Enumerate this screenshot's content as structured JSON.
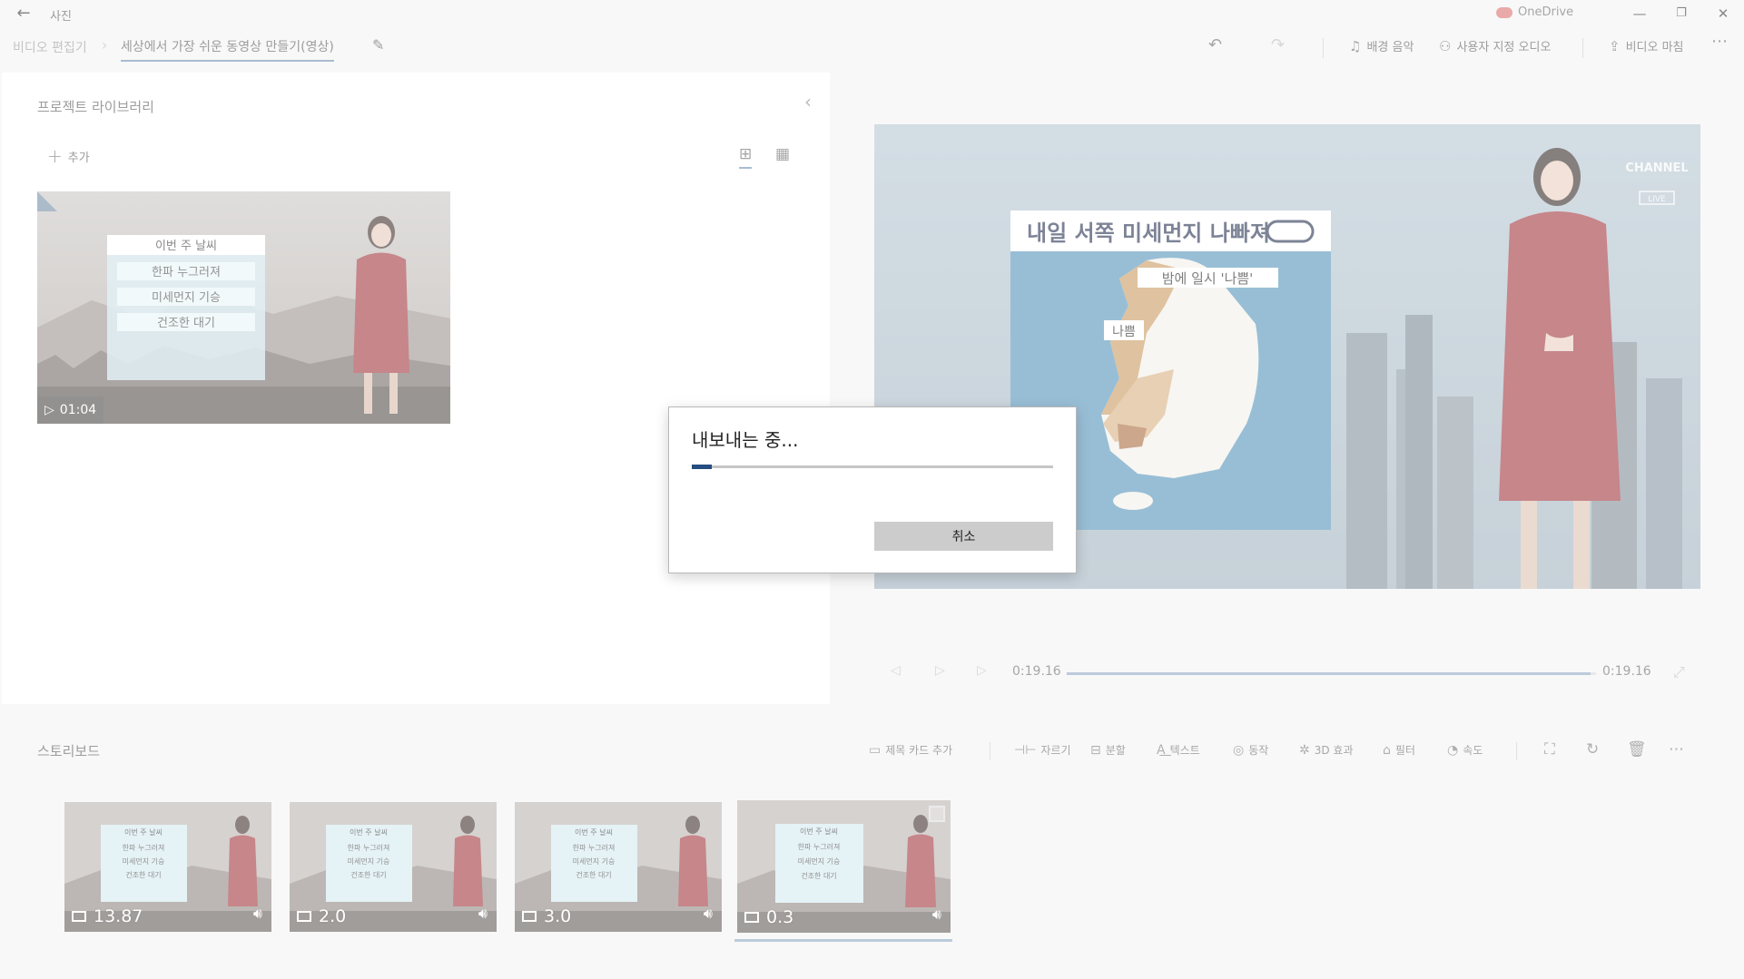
{
  "titlebar": {
    "app_name": "사진",
    "onedrive": "OneDrive"
  },
  "toolbar": {
    "breadcrumb_root": "비디오 편집기",
    "project_name": "세상에서 가장 쉬운 동영상 만들기(영상)",
    "bg_music": "배경 음악",
    "custom_audio": "사용자 지정 오디오",
    "finish_video": "비디오 마침"
  },
  "library": {
    "title": "프로젝트 라이브러리",
    "add_label": "추가",
    "thumb": {
      "duration": "01:04",
      "card_title": "이번 주 날씨",
      "card_items": [
        "한파 누그러져",
        "미세먼지 기승",
        "건조한 대기"
      ]
    }
  },
  "preview": {
    "headline": "내일 서쪽 미세먼지 나빠져",
    "label_night": "밤에 일시 '나쁨'",
    "label_bad": "나쁨",
    "channel": "CHANNEL",
    "live": "LIVE",
    "time_current": "0:19.16",
    "time_total": "0:19.16",
    "progress": 0.99
  },
  "storyboard": {
    "title": "스토리보드",
    "tools": {
      "title_card": "제목 카드 추가",
      "trim": "자르기",
      "split": "분할",
      "text": "텍스트",
      "motion": "동작",
      "effects_3d": "3D 효과",
      "filters": "필터",
      "speed": "속도"
    },
    "clips": [
      {
        "duration": "13.87"
      },
      {
        "duration": "2.0"
      },
      {
        "duration": "3.0"
      },
      {
        "duration": "0.3"
      }
    ],
    "clip_card": {
      "title": "이번 주 날씨",
      "items": [
        "한파 누그러져",
        "미세먼지 기승",
        "건조한 대기"
      ]
    }
  },
  "dialog": {
    "title": "내보내는 중...",
    "progress": 0.055,
    "cancel": "취소"
  },
  "colors": {
    "accent": "#254d80",
    "bar": "#8aa6c2",
    "suit": "#9e2f36"
  }
}
